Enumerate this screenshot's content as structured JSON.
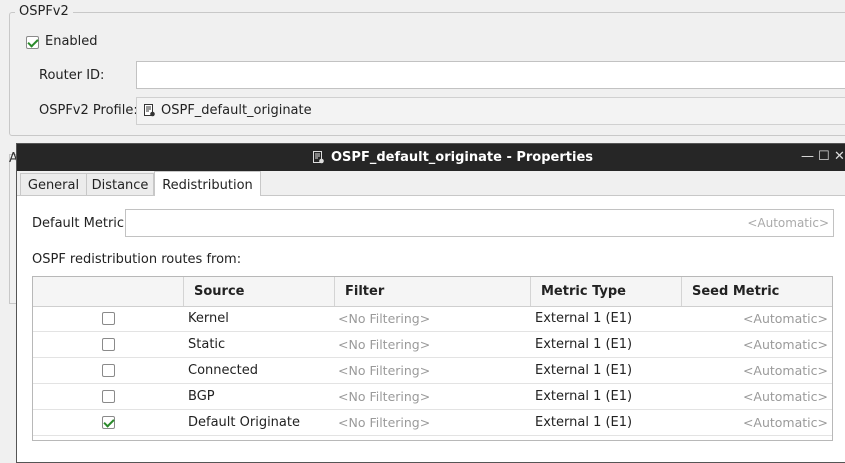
{
  "ospf": {
    "group_title": "OSPFv2",
    "enabled_label": "Enabled",
    "enabled_checked": true,
    "router_id_label": "Router ID:",
    "router_id_value": "",
    "profile_label": "OSPFv2 Profile:",
    "profile_value": "OSPF_default_originate"
  },
  "background_group_letter": "A",
  "dialog": {
    "title": "OSPF_default_originate - Properties",
    "controls": {
      "minimize": "—",
      "maximize": "☐",
      "close": "✕"
    },
    "tabs": [
      {
        "label": "General",
        "active": false
      },
      {
        "label": "Distance",
        "active": false
      },
      {
        "label": "Redistribution",
        "active": true
      }
    ],
    "default_metric_label": "Default Metric:",
    "default_metric_placeholder": "<Automatic>",
    "routes_label": "OSPF redistribution routes from:",
    "table": {
      "headers": [
        "",
        "Source",
        "Filter",
        "Metric Type",
        "Seed Metric"
      ],
      "rows": [
        {
          "checked": false,
          "source": "Kernel",
          "filter": "<No Filtering>",
          "metric_type": "External 1 (E1)",
          "seed": "<Automatic>"
        },
        {
          "checked": false,
          "source": "Static",
          "filter": "<No Filtering>",
          "metric_type": "External 1 (E1)",
          "seed": "<Automatic>"
        },
        {
          "checked": false,
          "source": "Connected",
          "filter": "<No Filtering>",
          "metric_type": "External 1 (E1)",
          "seed": "<Automatic>"
        },
        {
          "checked": false,
          "source": "BGP",
          "filter": "<No Filtering>",
          "metric_type": "External 1 (E1)",
          "seed": "<Automatic>"
        },
        {
          "checked": true,
          "source": "Default Originate",
          "filter": "<No Filtering>",
          "metric_type": "External 1 (E1)",
          "seed": "<Automatic>"
        }
      ]
    }
  },
  "colors": {
    "accent_check": "#2a8a2a",
    "titlebar": "#262626"
  }
}
